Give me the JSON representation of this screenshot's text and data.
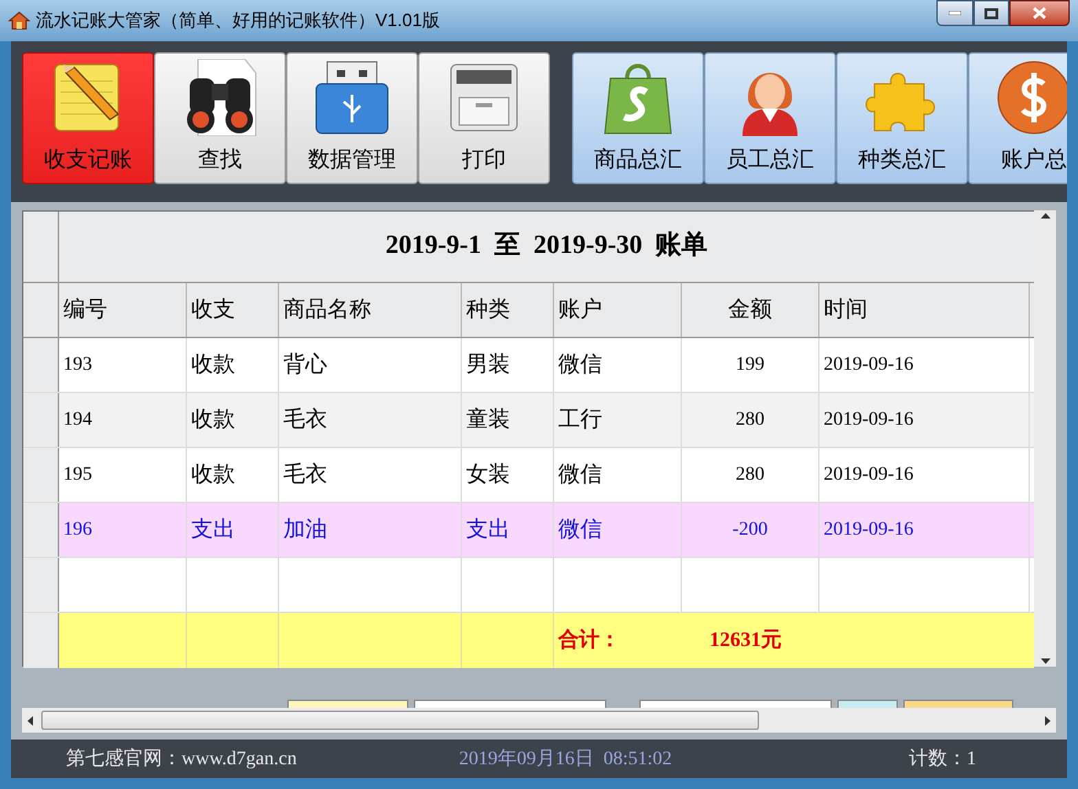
{
  "window": {
    "title": "流水记账大管家（简单、好用的记账软件）V1.01版"
  },
  "toolbar_left": [
    {
      "label": "收支记账",
      "selected": true
    },
    {
      "label": "查找",
      "selected": false
    },
    {
      "label": "数据管理",
      "selected": false
    },
    {
      "label": "打印",
      "selected": false
    }
  ],
  "toolbar_right": [
    {
      "label": "商品总汇",
      "selected": false
    },
    {
      "label": "员工总汇",
      "selected": false
    },
    {
      "label": "种类总汇",
      "selected": false
    },
    {
      "label": "账户总",
      "selected": false
    }
  ],
  "table": {
    "title": "2019-9-1  至  2019-9-30  账单",
    "columns": [
      "编号",
      "收支",
      "商品名称",
      "种类",
      "账户",
      "金额",
      "时间"
    ],
    "rows": [
      {
        "kind": "income",
        "cells": [
          "193",
          "收款",
          "背心",
          "男装",
          "微信",
          "199",
          "2019-09-16"
        ]
      },
      {
        "kind": "income",
        "cells": [
          "194",
          "收款",
          "毛衣",
          "童装",
          "工行",
          "280",
          "2019-09-16"
        ]
      },
      {
        "kind": "income",
        "cells": [
          "195",
          "收款",
          "毛衣",
          "女装",
          "微信",
          "280",
          "2019-09-16"
        ]
      },
      {
        "kind": "expense",
        "cells": [
          "196",
          "支出",
          "加油",
          "支出",
          "微信",
          "-200",
          "2019-09-16"
        ]
      }
    ],
    "total": {
      "label": "合计：",
      "value": "12631元"
    }
  },
  "status_bar": {
    "site": "第七感官网：www.d7gan.cn",
    "datetime": "2019年09月16日  08:51:02",
    "count": "计数：1"
  }
}
